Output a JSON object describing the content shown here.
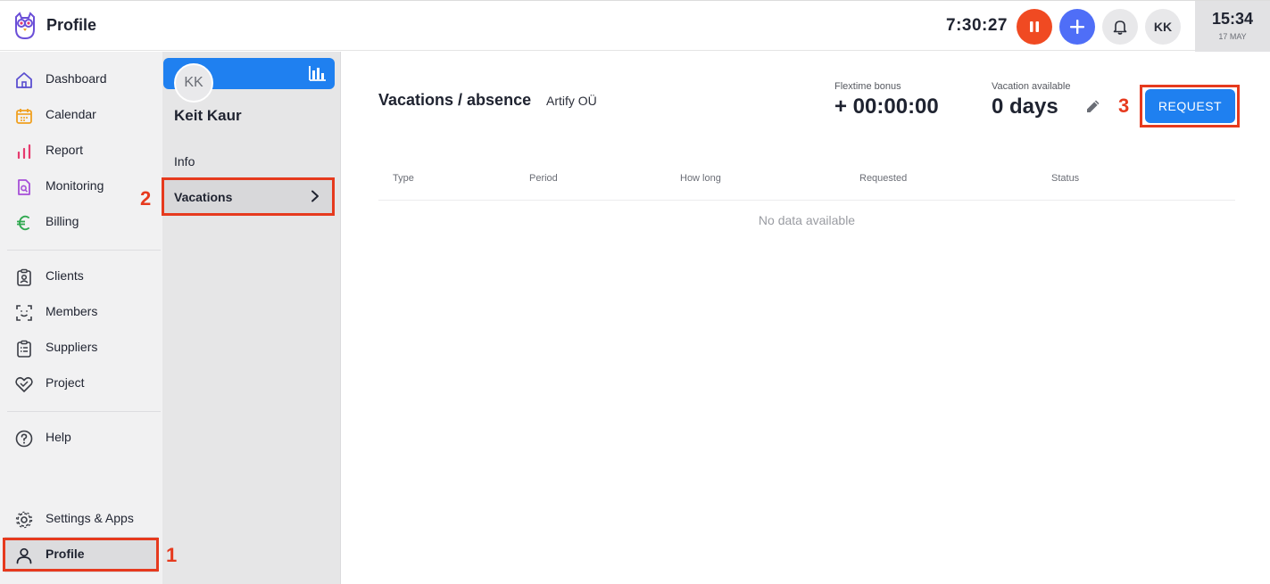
{
  "topbar": {
    "title": "Profile",
    "timer": "7:30:27",
    "avatar_initials": "KK",
    "clock_time": "15:34",
    "clock_date": "17 MAY"
  },
  "sidebar": {
    "items": [
      {
        "label": "Dashboard",
        "icon": "home-icon"
      },
      {
        "label": "Calendar",
        "icon": "calendar-icon"
      },
      {
        "label": "Report",
        "icon": "bar-chart-icon"
      },
      {
        "label": "Monitoring",
        "icon": "monitoring-icon"
      },
      {
        "label": "Billing",
        "icon": "euro-icon"
      },
      {
        "label": "Clients",
        "icon": "clients-icon"
      },
      {
        "label": "Members",
        "icon": "members-icon"
      },
      {
        "label": "Suppliers",
        "icon": "clipboard-icon"
      },
      {
        "label": "Project",
        "icon": "handshake-icon"
      },
      {
        "label": "Help",
        "icon": "help-icon"
      },
      {
        "label": "Settings & Apps",
        "icon": "gear-icon"
      },
      {
        "label": "Profile",
        "icon": "user-icon"
      }
    ]
  },
  "profile_panel": {
    "avatar_initials": "KK",
    "name": "Keit Kaur",
    "items": [
      {
        "label": "Info"
      },
      {
        "label": "Vacations"
      }
    ]
  },
  "main": {
    "title": "Vacations / absence",
    "company": "Artify OÜ",
    "flextime_label": "Flextime bonus",
    "flextime_value": "+ 00:00:00",
    "vacation_label": "Vacation available",
    "vacation_value": "0 days",
    "request_label": "REQUEST",
    "table": {
      "headers": [
        "Type",
        "Period",
        "How long",
        "Requested",
        "Status"
      ],
      "empty_text": "No data available"
    }
  },
  "annotations": {
    "step1": "1",
    "step2": "2",
    "step3": "3",
    "color": "#e63a1e"
  },
  "colors": {
    "accent_blue": "#1f80f0",
    "pause_orange": "#f04a22",
    "add_blue": "#4f6ef7"
  }
}
